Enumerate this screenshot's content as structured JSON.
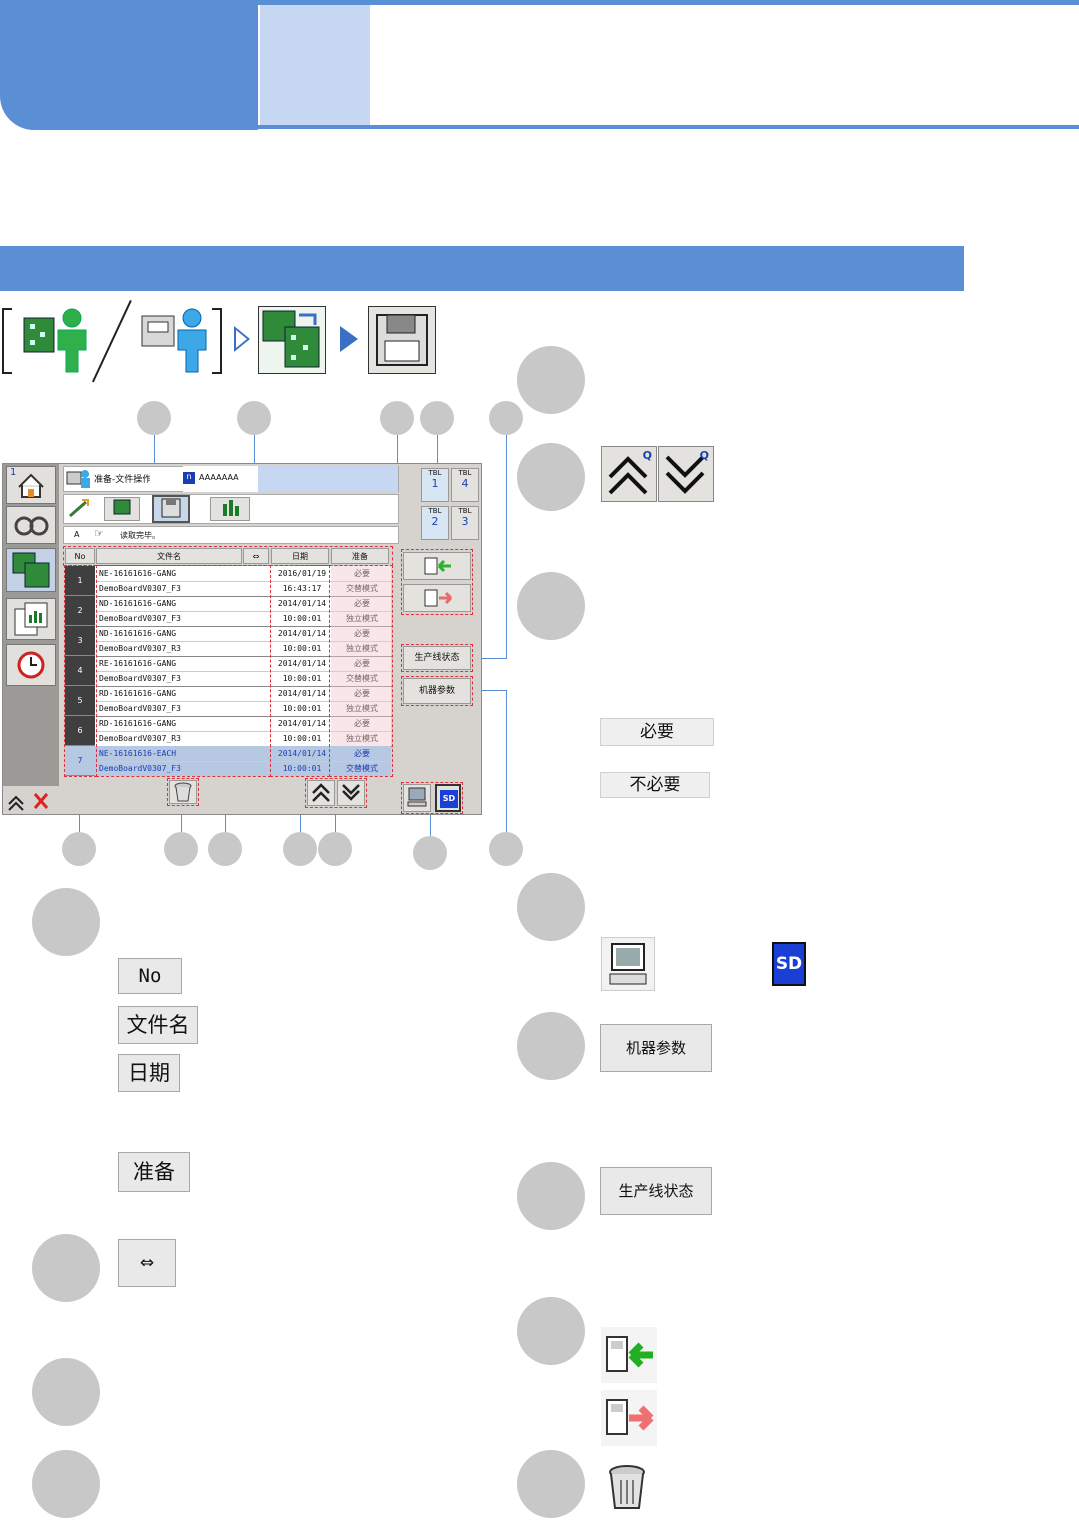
{
  "screen": {
    "title": "准备-文件操作",
    "machine_name": "AAAAAAA",
    "status_prefix": "A",
    "status_message": "读取完毕。",
    "table_headers": {
      "no": "No",
      "name": "文件名",
      "swap": "⇔",
      "date": "日期",
      "prep": "准备"
    },
    "groups": [
      {
        "no": "1",
        "rows": [
          {
            "name": "NE-16161616-GANG",
            "value": "2016/01/19",
            "prep": "必要"
          },
          {
            "name": "DemoBoardV0307_F3",
            "value": "16:43:17",
            "prep": "交替模式"
          }
        ]
      },
      {
        "no": "2",
        "rows": [
          {
            "name": "ND-16161616-GANG",
            "value": "2014/01/14",
            "prep": "必要"
          },
          {
            "name": "DemoBoardV0307_F3",
            "value": "10:00:01",
            "prep": "独立模式"
          }
        ]
      },
      {
        "no": "3",
        "rows": [
          {
            "name": "ND-16161616-GANG",
            "value": "2014/01/14",
            "prep": "必要"
          },
          {
            "name": "DemoBoardV0307_R3",
            "value": "10:00:01",
            "prep": "独立模式"
          }
        ]
      },
      {
        "no": "4",
        "rows": [
          {
            "name": "RE-16161616-GANG",
            "value": "2014/01/14",
            "prep": "必要"
          },
          {
            "name": "DemoBoardV0307_F3",
            "value": "10:00:01",
            "prep": "交替模式"
          }
        ]
      },
      {
        "no": "5",
        "rows": [
          {
            "name": "RD-16161616-GANG",
            "value": "2014/01/14",
            "prep": "必要"
          },
          {
            "name": "DemoBoardV0307_F3",
            "value": "10:00:01",
            "prep": "独立模式"
          }
        ]
      },
      {
        "no": "6",
        "rows": [
          {
            "name": "RD-16161616-GANG",
            "value": "2014/01/14",
            "prep": "必要"
          },
          {
            "name": "DemoBoardV0307_R3",
            "value": "10:00:01",
            "prep": "独立模式"
          }
        ]
      },
      {
        "no": "7",
        "rows": [
          {
            "name": "NE-16161616-EACH",
            "value": "2014/01/14",
            "prep": "必要"
          },
          {
            "name": "DemoBoardV0307_F3",
            "value": "10:00:01",
            "prep": "交替模式"
          }
        ]
      }
    ],
    "tbl_labels": [
      {
        "top": "TBL",
        "num": "1"
      },
      {
        "top": "TBL",
        "num": "4"
      },
      {
        "top": "TBL",
        "num": "2"
      },
      {
        "top": "TBL",
        "num": "3"
      }
    ],
    "line_status_btn": "生产线状态",
    "machine_params_btn": "机器参数",
    "sd_label": "SD",
    "side_num": "1"
  },
  "legend_left": {
    "no": "No",
    "name": "文件名",
    "date": "日期",
    "prep": "准备",
    "swap": "⇔"
  },
  "legend_right": {
    "up_q": "Q",
    "down_q": "Q",
    "required": "必要",
    "not_required": "不必要",
    "sd": "SD",
    "machine_params": "机器参数",
    "line_status": "生产线状态"
  },
  "colors": {
    "brand_blue": "#5a8fd6",
    "light_blue": "#c6d8f1",
    "highlight_dash": "#e0303c"
  }
}
